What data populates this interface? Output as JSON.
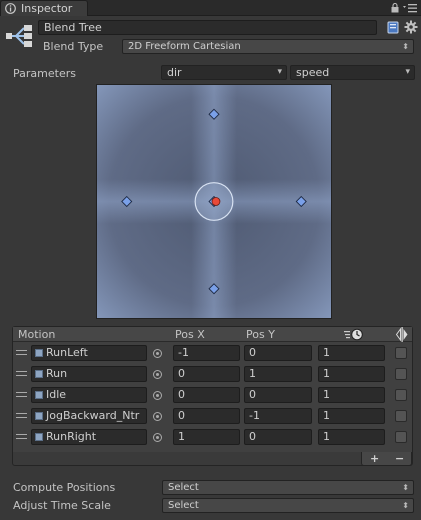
{
  "window": {
    "tab_title": "Inspector",
    "lock_icon": "lock-icon",
    "menu_icon": "context-menu-icon"
  },
  "header": {
    "icon": "blend-tree-icon",
    "name_value": "Blend Tree",
    "blend_type_label": "Blend Type",
    "blend_type_value": "2D Freeform Cartesian",
    "help_icon": "book-icon",
    "settings_icon": "gear-icon"
  },
  "parameters": {
    "label": "Parameters",
    "x_param": "dir",
    "y_param": "speed"
  },
  "blend_space": {
    "points": [
      {
        "motion": "RunLeft",
        "x": -1,
        "y": 0
      },
      {
        "motion": "Run",
        "x": 0,
        "y": 1
      },
      {
        "motion": "Idle",
        "x": 0,
        "y": 0
      },
      {
        "motion": "JogBackward",
        "x": 0,
        "y": -1
      },
      {
        "motion": "RunRight",
        "x": 1,
        "y": 0
      }
    ],
    "current": {
      "x": 0,
      "y": 0
    },
    "range_x": [
      -1,
      1
    ],
    "range_y": [
      -1,
      1
    ],
    "colors": {
      "background": "#5a6580",
      "highlight": "#8fa3c8",
      "point": "#7aa0e8",
      "current": "#e84a3a"
    }
  },
  "motion_table": {
    "headers": {
      "motion": "Motion",
      "pos_x": "Pos X",
      "pos_y": "Pos Y",
      "speed_icon": "time-scale-icon",
      "mirror_icon": "mirror-icon"
    },
    "rows": [
      {
        "motion": "RunLeft",
        "pos_x": "-1",
        "pos_y": "0",
        "speed": "1",
        "mirror": false
      },
      {
        "motion": "Run",
        "pos_x": "0",
        "pos_y": "1",
        "speed": "1",
        "mirror": false
      },
      {
        "motion": "Idle",
        "pos_x": "0",
        "pos_y": "0",
        "speed": "1",
        "mirror": false
      },
      {
        "motion": "JogBackward_Ntr",
        "pos_x": "0",
        "pos_y": "-1",
        "speed": "1",
        "mirror": false
      },
      {
        "motion": "RunRight",
        "pos_x": "1",
        "pos_y": "0",
        "speed": "1",
        "mirror": false
      }
    ],
    "add_label": "+",
    "remove_label": "−"
  },
  "bottom": {
    "compute_positions_label": "Compute Positions",
    "compute_positions_value": "Select",
    "adjust_time_scale_label": "Adjust Time Scale",
    "adjust_time_scale_value": "Select"
  }
}
